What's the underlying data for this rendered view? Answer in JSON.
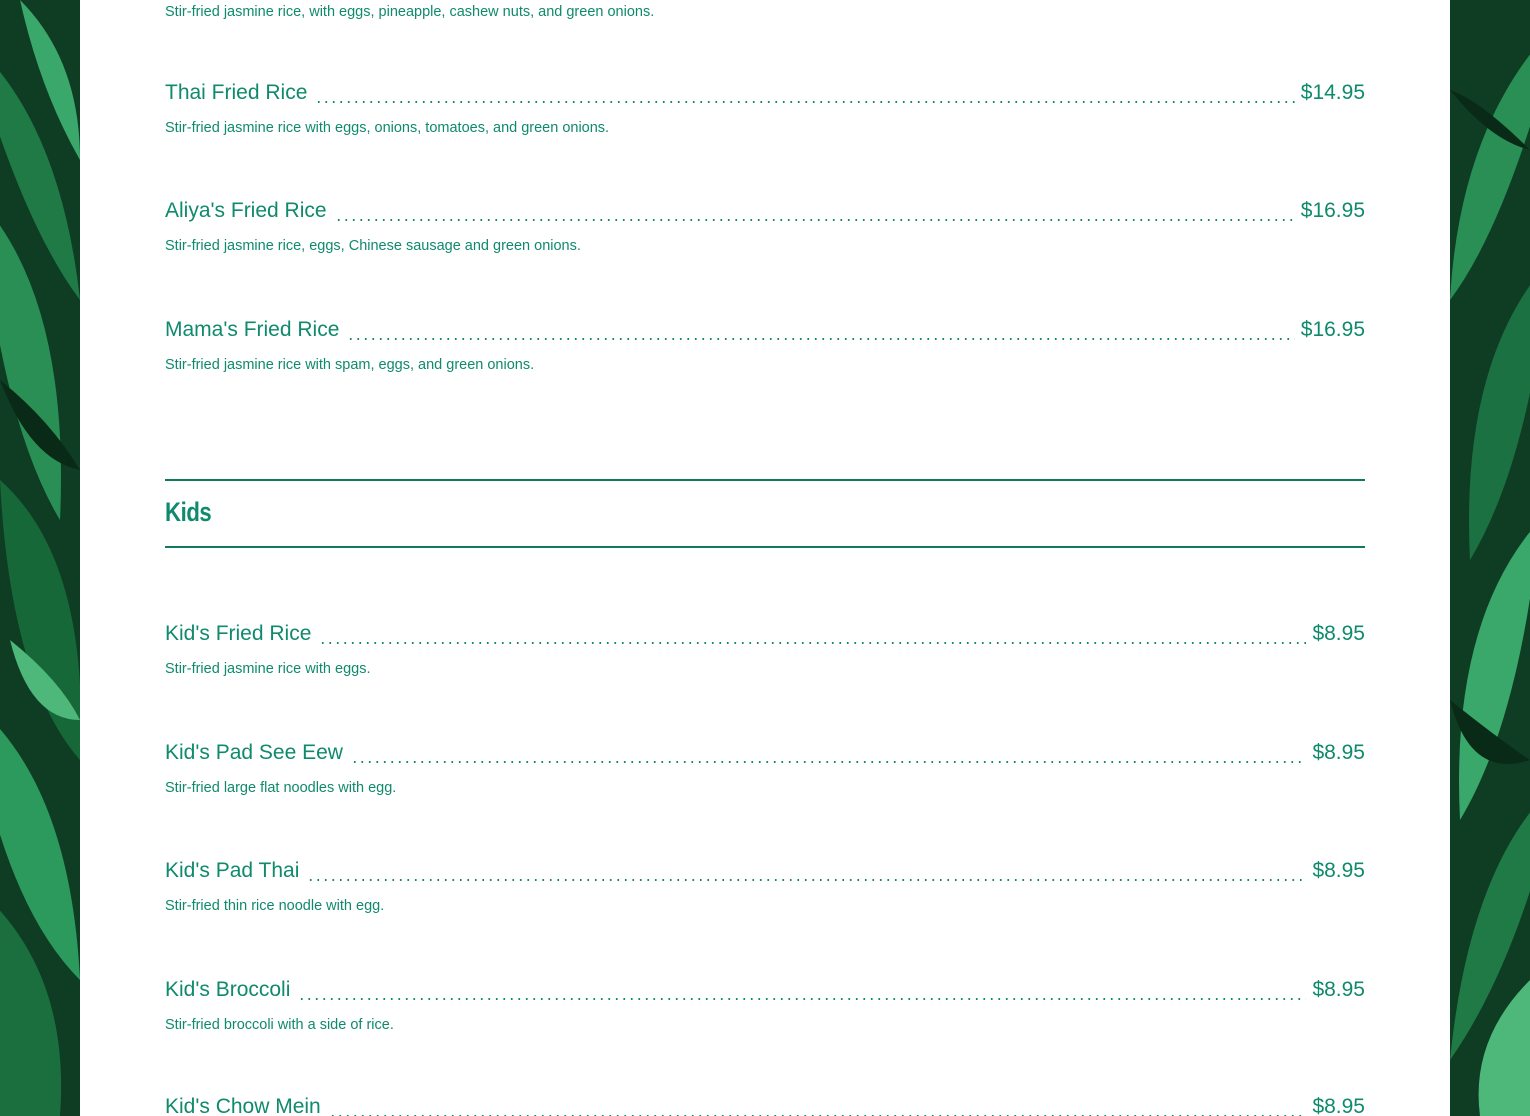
{
  "colors": {
    "accent": "#0f8a6c",
    "rule": "#0f7a5e",
    "paper": "#ffffff",
    "leaf_dark": "#0f3d24"
  },
  "top_item_desc": "Stir-fried jasmine rice, with eggs, pineapple, cashew nuts, and green onions.",
  "fried_rice_items": [
    {
      "name": "Thai Fried Rice",
      "price": "$14.95",
      "desc": "Stir-fried jasmine rice with eggs, onions, tomatoes, and green onions."
    },
    {
      "name": "Aliya's Fried Rice",
      "price": "$16.95",
      "desc": "Stir-fried jasmine rice, eggs, Chinese sausage and green onions."
    },
    {
      "name": "Mama's Fried Rice",
      "price": "$16.95",
      "desc": "Stir-fried jasmine rice with spam, eggs, and green onions."
    }
  ],
  "kids_section": {
    "title": "Kids",
    "items": [
      {
        "name": "Kid's Fried Rice",
        "price": "$8.95",
        "desc": "Stir-fried jasmine rice with eggs."
      },
      {
        "name": "Kid's Pad See Eew",
        "price": "$8.95",
        "desc": "Stir-fried large flat noodles with egg."
      },
      {
        "name": "Kid's Pad Thai",
        "price": "$8.95",
        "desc": "Stir-fried thin rice noodle with egg."
      },
      {
        "name": "Kid's Broccoli",
        "price": "$8.95",
        "desc": "Stir-fried broccoli with a side of rice."
      },
      {
        "name": "Kid's Chow Mein",
        "price": "$8.95"
      }
    ]
  }
}
